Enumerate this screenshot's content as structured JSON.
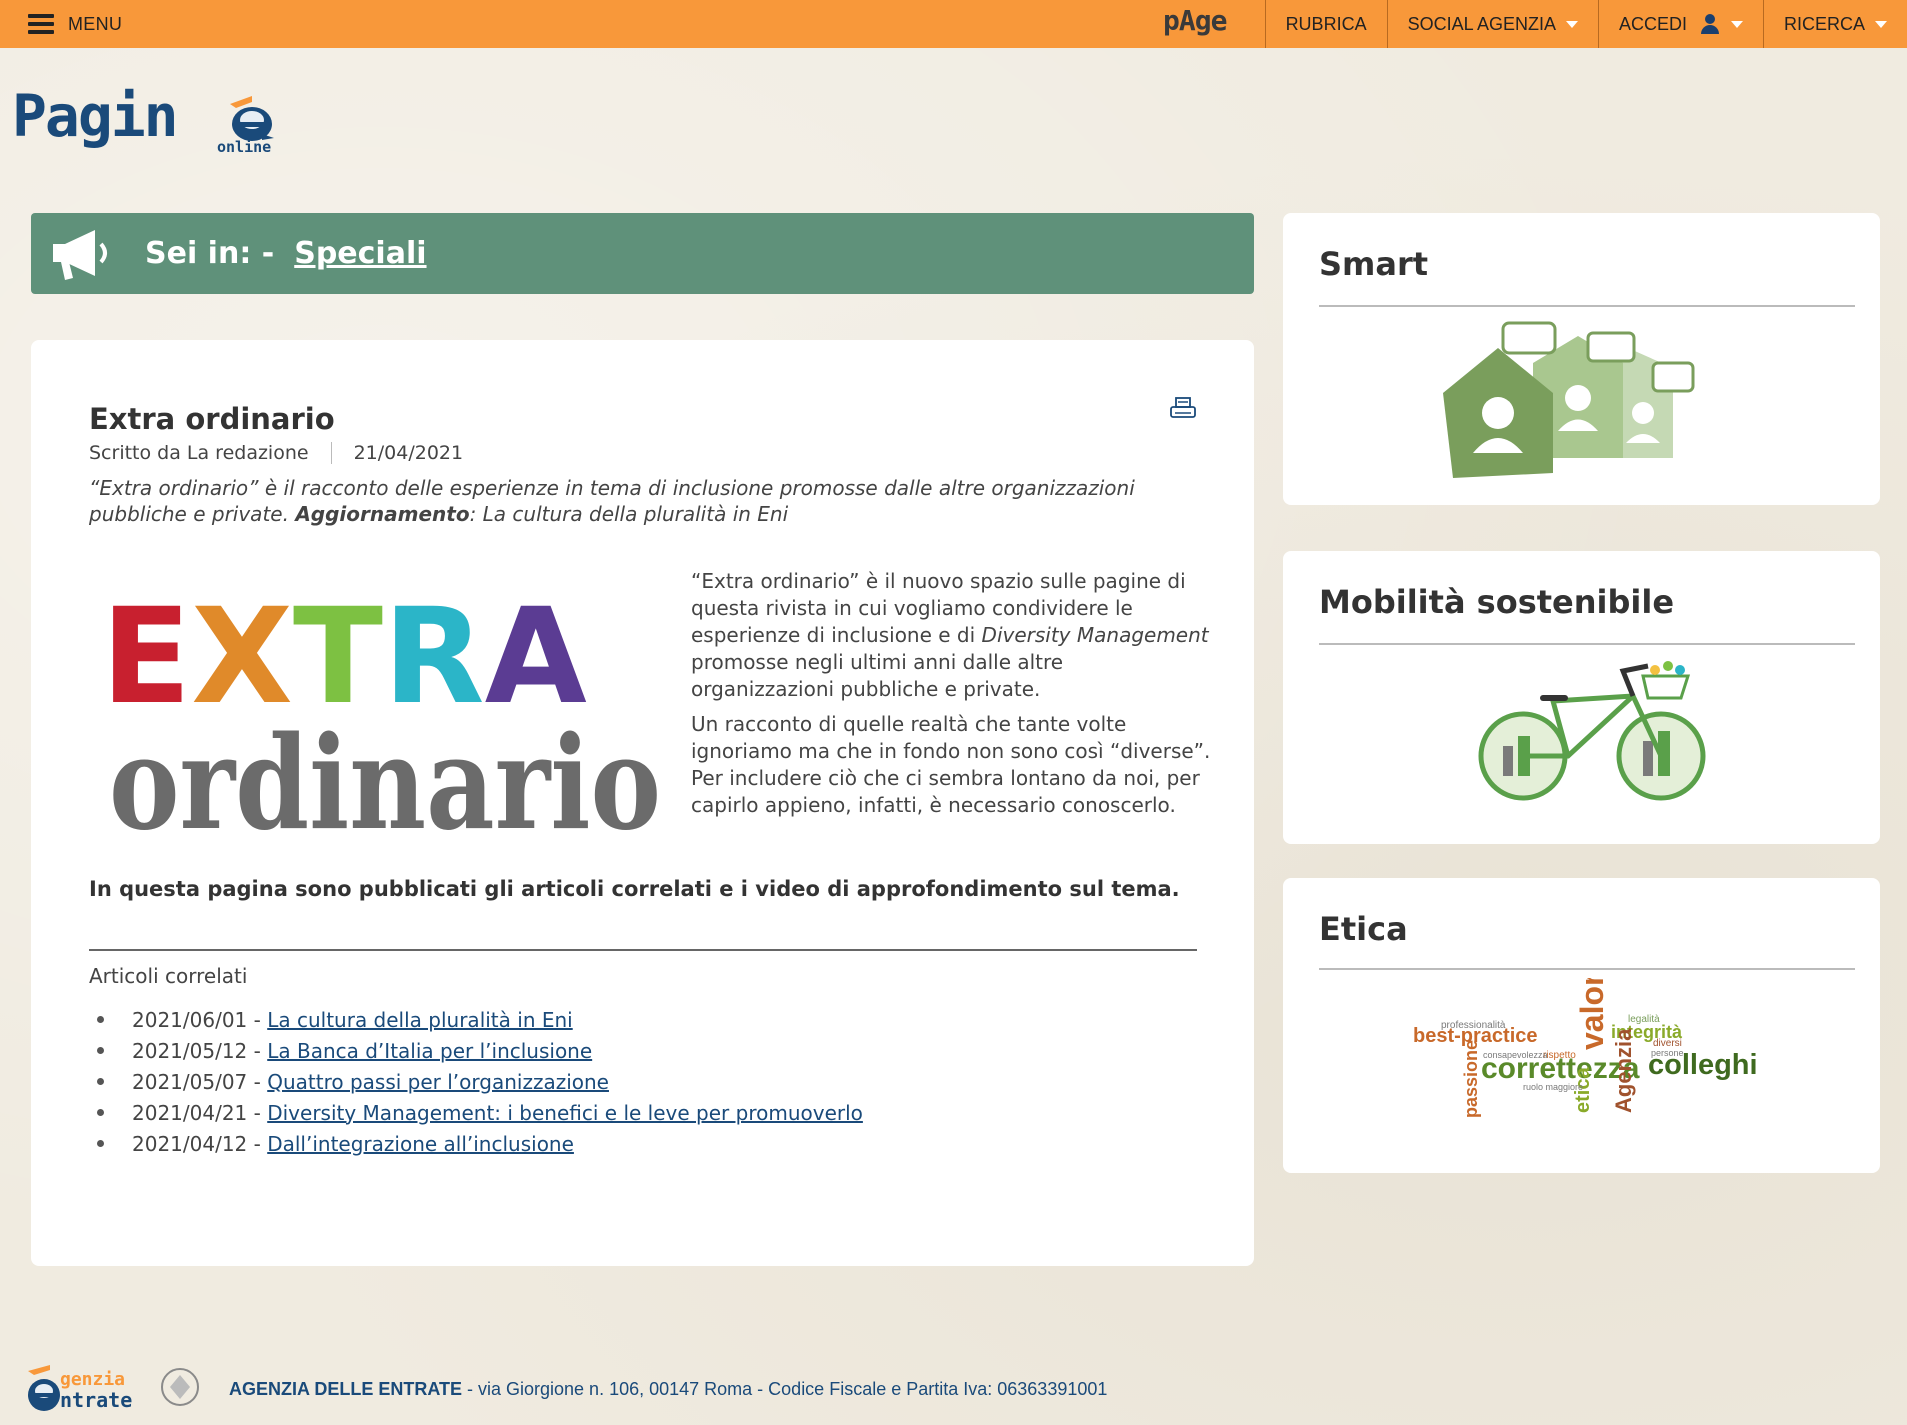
{
  "topbar": {
    "menu_label": "MENU",
    "brand": "pAge",
    "nav": [
      {
        "label": "RUBRICA"
      },
      {
        "label": "SOCIAL AGENZIA"
      },
      {
        "label": "ACCEDI"
      },
      {
        "label": "RICERCA"
      }
    ]
  },
  "logo": {
    "main": "Pagin",
    "sub": "online"
  },
  "breadcrumb": {
    "label": "Sei in: -",
    "link": "Speciali"
  },
  "article": {
    "title": "Extra ordinario",
    "author": "Scritto da La redazione",
    "date": "21/04/2021",
    "lead_pre": "“Extra ordinario” è il racconto delle esperienze in tema di inclusione promosse dalle altre organizzazioni pubbliche e private. ",
    "lead_bold": "Aggiornamento",
    "lead_post": ": La cultura della pluralità in Eni",
    "image": {
      "line1": "EXTRA",
      "line2": "ordinario"
    },
    "p1_pre": "“Extra ordinario” è il nuovo spazio sulle pagine di questa rivista in cui vogliamo condividere le esperienze di inclusione e di ",
    "p1_italic": "Diversity Management",
    "p1_post": " promosse negli ultimi anni dalle altre organizzazioni pubbliche e private.",
    "p2": "Un racconto di quelle realtà che tante volte ignoriamo ma che in fondo non sono così “diverse”. Per includere ciò che ci sembra lontano da noi, per capirlo appieno, infatti, è necessario conoscerlo.",
    "note": "In questa pagina sono pubblicati gli articoli correlati e i video di approfondimento sul tema.",
    "related_title": "Articoli correlati",
    "related": [
      {
        "date": "2021/06/01 -",
        "title": "La cultura della pluralità in Eni"
      },
      {
        "date": "2021/05/12 -",
        "title": "La Banca d’Italia per l’inclusione"
      },
      {
        "date": "2021/05/07 -",
        "title": "Quattro passi per l’organizzazione"
      },
      {
        "date": "2021/04/21 -",
        "title": "Diversity Management: i benefici e le leve per promuoverlo"
      },
      {
        "date": "2021/04/12 -",
        "title": "Dall’integrazione all’inclusione"
      }
    ]
  },
  "sidebar": [
    {
      "title": "Smart"
    },
    {
      "title": "Mobilità sostenibile"
    },
    {
      "title": "Etica"
    }
  ],
  "wordcloud": [
    "best-practice",
    "correttezza",
    "colleghi",
    "valore",
    "integrità",
    "passione",
    "Agenzia",
    "etica",
    "legalità",
    "professionalità",
    "rispetto",
    "consapevolezza",
    "diversi",
    "persone",
    "ruolo maggiore"
  ],
  "footer": {
    "logo_line1": "genzia",
    "logo_line2": "ntrate",
    "org": "AGENZIA DELLE ENTRATE",
    "address": " - via Giorgione n. 106, 00147 Roma - Codice Fiscale e Partita Iva: 06363391001"
  },
  "colors": {
    "topbar": "#f8983a",
    "crumb": "#5f917a",
    "link": "#1a4a7a"
  }
}
